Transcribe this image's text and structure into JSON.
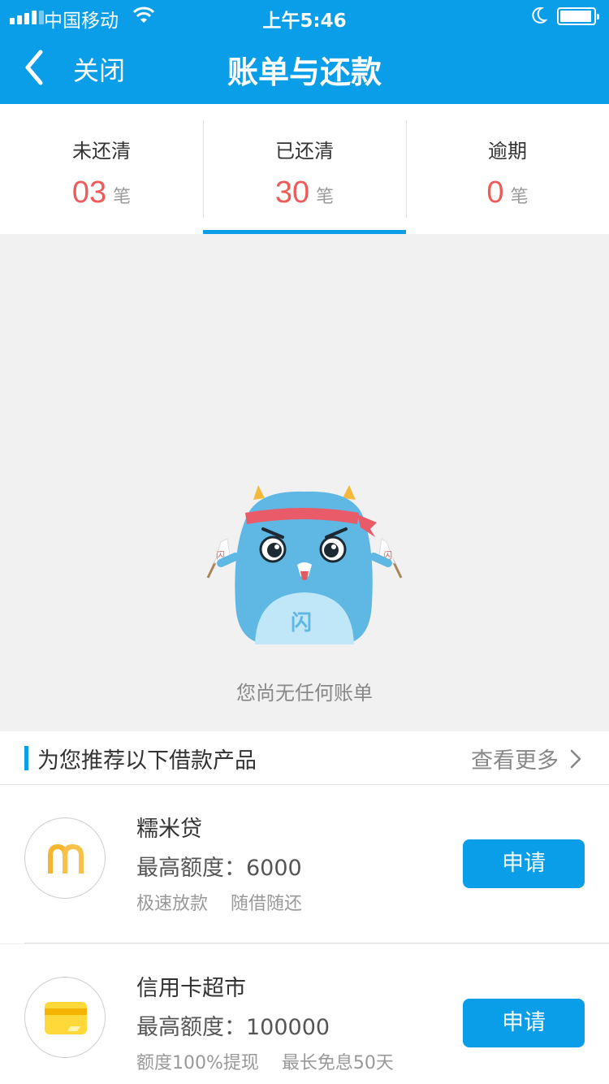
{
  "status_bar": {
    "carrier": "中国移动",
    "time": "上午5:46"
  },
  "nav": {
    "close_label": "关闭",
    "title": "账单与还款"
  },
  "tabs": [
    {
      "label": "未还清",
      "count": "03",
      "unit": "笔",
      "active": false
    },
    {
      "label": "已还清",
      "count": "30",
      "unit": "笔",
      "active": true
    },
    {
      "label": "逾期",
      "count": "0",
      "unit": "笔",
      "active": false
    }
  ],
  "empty_state": {
    "message": "您尚无任何账单",
    "mascot_badge": "闪"
  },
  "recommend": {
    "title": "为您推荐以下借款产品",
    "more_label": "查看更多"
  },
  "products": [
    {
      "name": "糯米贷",
      "limit": "最高额度：6000",
      "tags": [
        "极速放款",
        "随借随还"
      ],
      "apply_label": "申请",
      "icon": "nuomi-logo-icon"
    },
    {
      "name": "信用卡超市",
      "limit": "最高额度：100000",
      "tags": [
        "额度100%提现",
        "最长免息50天"
      ],
      "apply_label": "申请",
      "icon": "credit-card-icon"
    }
  ],
  "colors": {
    "brand": "#0a9de8",
    "count_red": "#ef5b5b",
    "background": "#f1f1f1"
  }
}
